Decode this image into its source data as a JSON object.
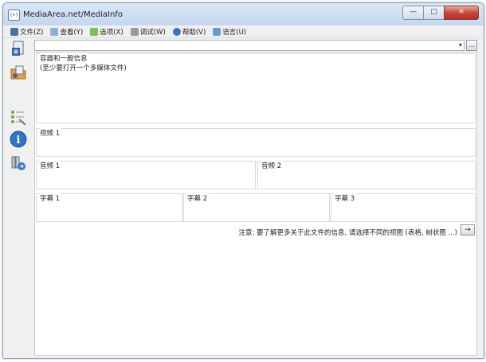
{
  "window": {
    "title": "MediaArea.net/MediaInfo",
    "app_icon_glyph": "(•)",
    "buttons": {
      "minimize": "—",
      "maximize": "□",
      "close": "✕"
    }
  },
  "menu": {
    "items": [
      {
        "label": "文件(Z)",
        "icon": "file-icon",
        "color": "#4a6fa5"
      },
      {
        "label": "查看(Y)",
        "icon": "view-icon",
        "color": "#8fb0d8"
      },
      {
        "label": "选项(X)",
        "icon": "options-icon",
        "color": "#7bbf5a"
      },
      {
        "label": "调试(W)",
        "icon": "debug-icon",
        "color": "#9a9a9a"
      },
      {
        "label": "帮助(V)",
        "icon": "help-icon",
        "color": "#3a72c4"
      },
      {
        "label": "语言(U)",
        "icon": "language-icon",
        "color": "#6a9ad0"
      }
    ]
  },
  "sidebar": {
    "icons": [
      "open-file-icon",
      "open-folder-icon",
      "sheet-view-icon",
      "info-icon",
      "export-icon"
    ]
  },
  "combo": {
    "value": "",
    "arrow": "▾",
    "button_label": "..."
  },
  "sections": {
    "general": {
      "title": "容器和一般信息",
      "text": "(至少要打开一个多媒体文件)"
    },
    "video1": {
      "title": "视频 1"
    },
    "audio1": {
      "title": "音频 1"
    },
    "audio2": {
      "title": "音频 2"
    },
    "text1": {
      "title": "字幕 1"
    },
    "text2": {
      "title": "字幕 2"
    },
    "text3": {
      "title": "字幕 3"
    }
  },
  "note": {
    "text": "注意: 要了解更多关于此文件的信息, 请选择不同的视图 (表格, 树状图 ...)",
    "button_label": "→"
  }
}
